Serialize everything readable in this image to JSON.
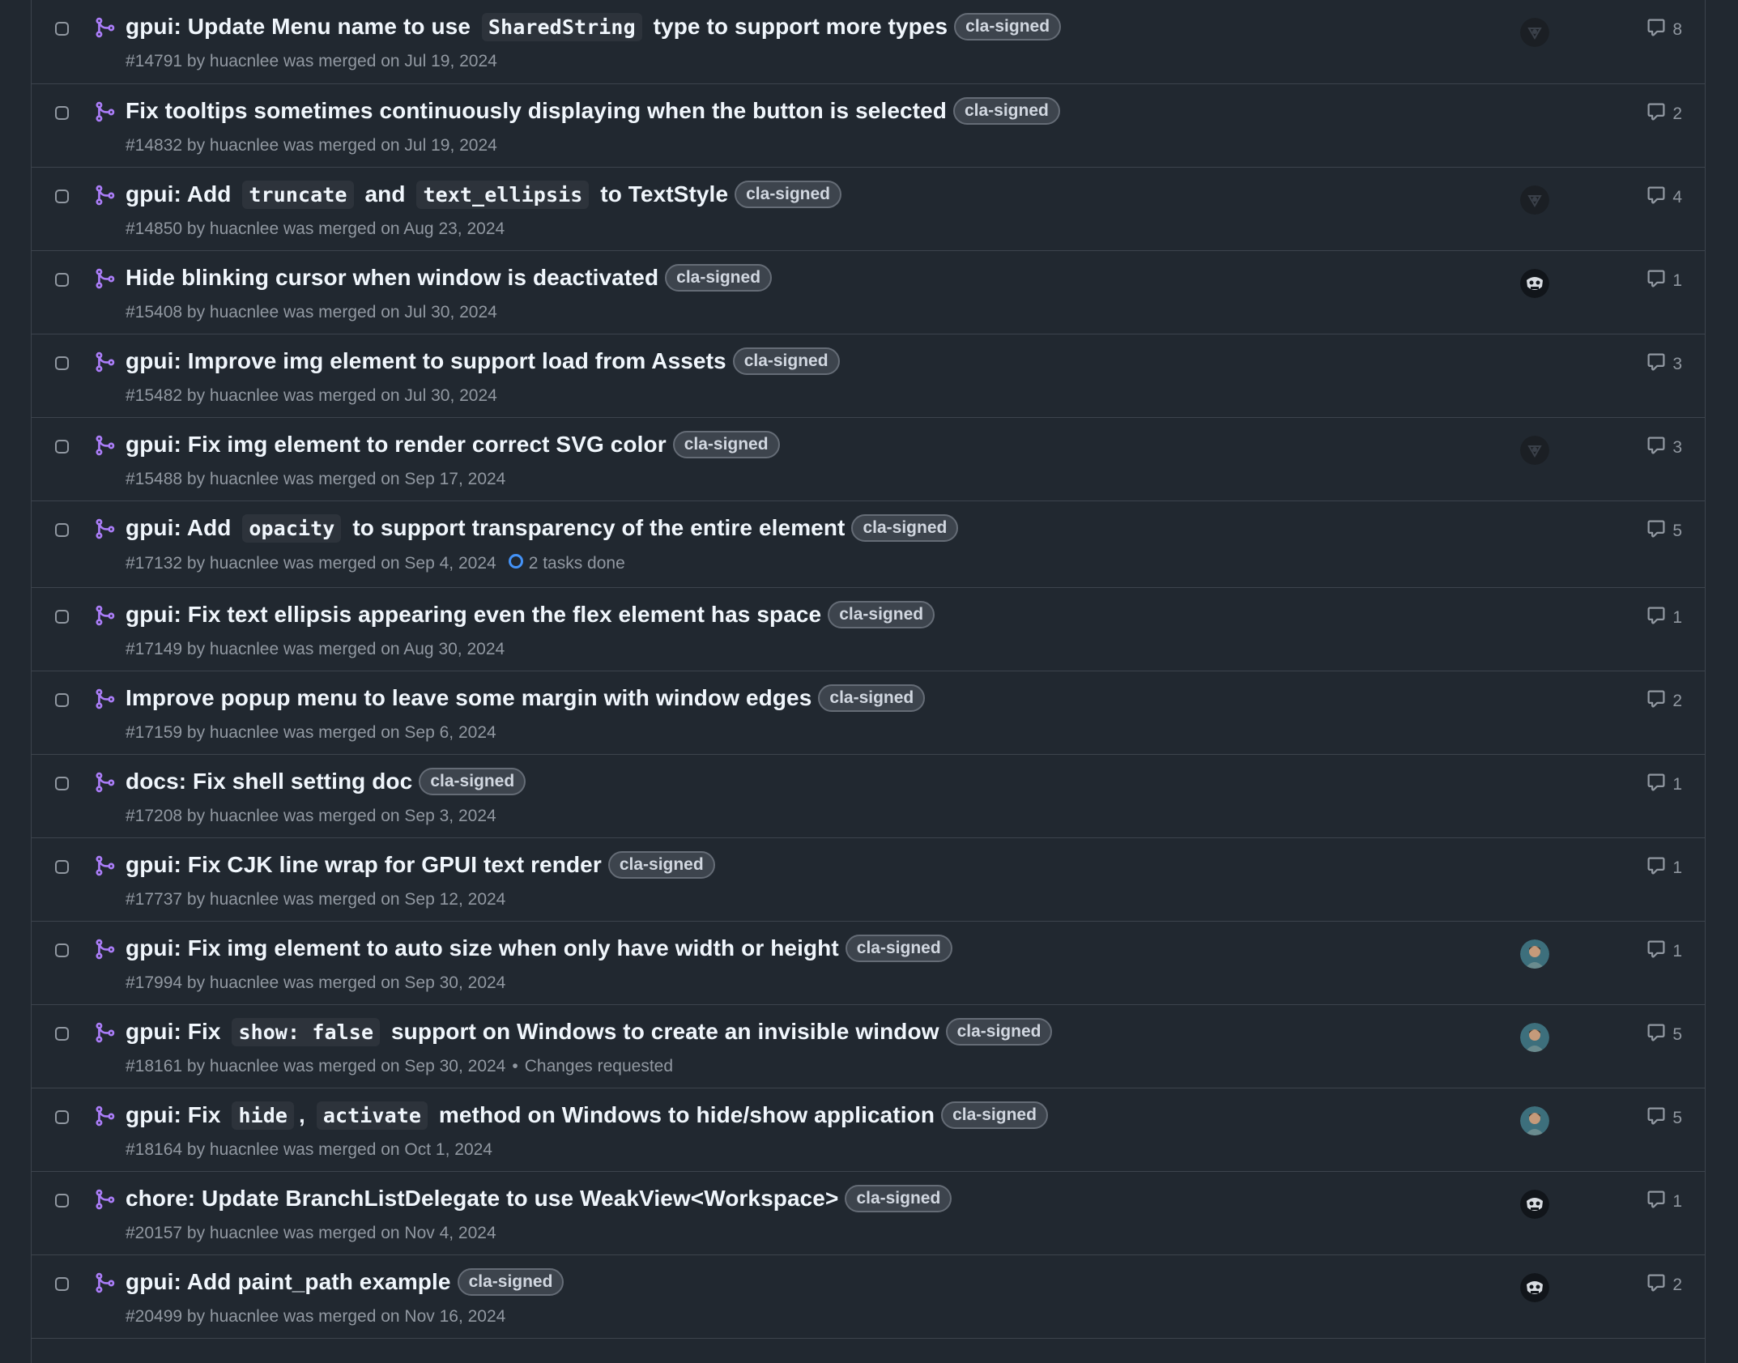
{
  "rows": [
    {
      "title_parts": [
        [
          "t",
          "gpui: Update Menu name to use "
        ],
        [
          "c",
          "SharedString"
        ],
        [
          "t",
          " type to support more types"
        ]
      ],
      "label": "cla-signed",
      "meta": "#14791 by huacnlee was merged on Jul 19, 2024",
      "avatar": "logo",
      "comments": "8"
    },
    {
      "title_parts": [
        [
          "t",
          "Fix tooltips sometimes continuously displaying when the button is selected"
        ]
      ],
      "label": "cla-signed",
      "meta": "#14832 by huacnlee was merged on Jul 19, 2024",
      "avatar": "",
      "comments": "2"
    },
    {
      "title_parts": [
        [
          "t",
          "gpui: Add "
        ],
        [
          "c",
          "truncate"
        ],
        [
          "t",
          " and "
        ],
        [
          "c",
          "text_ellipsis"
        ],
        [
          "t",
          " to TextStyle"
        ]
      ],
      "label": "cla-signed",
      "meta": "#14850 by huacnlee was merged on Aug 23, 2024",
      "avatar": "logo",
      "comments": "4"
    },
    {
      "title_parts": [
        [
          "t",
          "Hide blinking cursor when window is deactivated"
        ]
      ],
      "label": "cla-signed",
      "meta": "#15408 by huacnlee was merged on Jul 30, 2024",
      "avatar": "mask",
      "comments": "1"
    },
    {
      "title_parts": [
        [
          "t",
          "gpui: Improve img element to support load from Assets"
        ]
      ],
      "label": "cla-signed",
      "meta": "#15482 by huacnlee was merged on Jul 30, 2024",
      "avatar": "",
      "comments": "3"
    },
    {
      "title_parts": [
        [
          "t",
          "gpui: Fix img element to render correct SVG color"
        ]
      ],
      "label": "cla-signed",
      "meta": "#15488 by huacnlee was merged on Sep 17, 2024",
      "avatar": "logo",
      "comments": "3"
    },
    {
      "title_parts": [
        [
          "t",
          "gpui: Add "
        ],
        [
          "c",
          "opacity"
        ],
        [
          "t",
          " to support transparency of the entire element"
        ]
      ],
      "label": "cla-signed",
      "meta": "#17132 by huacnlee was merged on Sep 4, 2024",
      "tasks": "2 tasks done",
      "avatar": "",
      "comments": "5",
      "tall": true
    },
    {
      "title_parts": [
        [
          "t",
          "gpui: Fix text ellipsis appearing even the flex element has space"
        ]
      ],
      "label": "cla-signed",
      "meta": "#17149 by huacnlee was merged on Aug 30, 2024",
      "avatar": "",
      "comments": "1"
    },
    {
      "title_parts": [
        [
          "t",
          "Improve popup menu to leave some margin with window edges"
        ]
      ],
      "label": "cla-signed",
      "meta": "#17159 by huacnlee was merged on Sep 6, 2024",
      "avatar": "",
      "comments": "2"
    },
    {
      "title_parts": [
        [
          "t",
          "docs: Fix shell setting doc"
        ]
      ],
      "label": "cla-signed",
      "meta": "#17208 by huacnlee was merged on Sep 3, 2024",
      "avatar": "",
      "comments": "1"
    },
    {
      "title_parts": [
        [
          "t",
          "gpui: Fix CJK line wrap for GPUI text render"
        ]
      ],
      "label": "cla-signed",
      "meta": "#17737 by huacnlee was merged on Sep 12, 2024",
      "avatar": "",
      "comments": "1"
    },
    {
      "title_parts": [
        [
          "t",
          "gpui: Fix img element to auto size when only have width or height"
        ]
      ],
      "label": "cla-signed",
      "meta": "#17994 by huacnlee was merged on Sep 30, 2024",
      "avatar": "photo",
      "comments": "1"
    },
    {
      "title_parts": [
        [
          "t",
          "gpui: Fix "
        ],
        [
          "c",
          "show: false"
        ],
        [
          "t",
          " support on Windows to create an invisible window"
        ]
      ],
      "label": "cla-signed",
      "meta": "#18161 by huacnlee was merged on Sep 30, 2024",
      "extra": "Changes requested",
      "avatar": "photo",
      "comments": "5"
    },
    {
      "title_parts": [
        [
          "t",
          "gpui: Fix "
        ],
        [
          "c",
          "hide"
        ],
        [
          "t",
          ", "
        ],
        [
          "c",
          "activate"
        ],
        [
          "t",
          " method on Windows to hide/show application"
        ]
      ],
      "label": "cla-signed",
      "meta": "#18164 by huacnlee was merged on Oct 1, 2024",
      "avatar": "photo",
      "comments": "5"
    },
    {
      "title_parts": [
        [
          "t",
          "chore: Update BranchListDelegate to use WeakView<Workspace>"
        ]
      ],
      "label": "cla-signed",
      "meta": "#20157 by huacnlee was merged on Nov 4, 2024",
      "avatar": "mask",
      "comments": "1"
    },
    {
      "title_parts": [
        [
          "t",
          "gpui: Add paint_path example"
        ]
      ],
      "label": "cla-signed",
      "meta": "#20499 by huacnlee was merged on Nov 16, 2024",
      "avatar": "mask",
      "comments": "2"
    }
  ],
  "colors": {
    "merged": "#ab7df8",
    "tasks": "#4493f8"
  },
  "icons": {
    "merged": "git-merge-icon",
    "comment": "comment-icon",
    "tasks": "progress-circle-icon"
  }
}
